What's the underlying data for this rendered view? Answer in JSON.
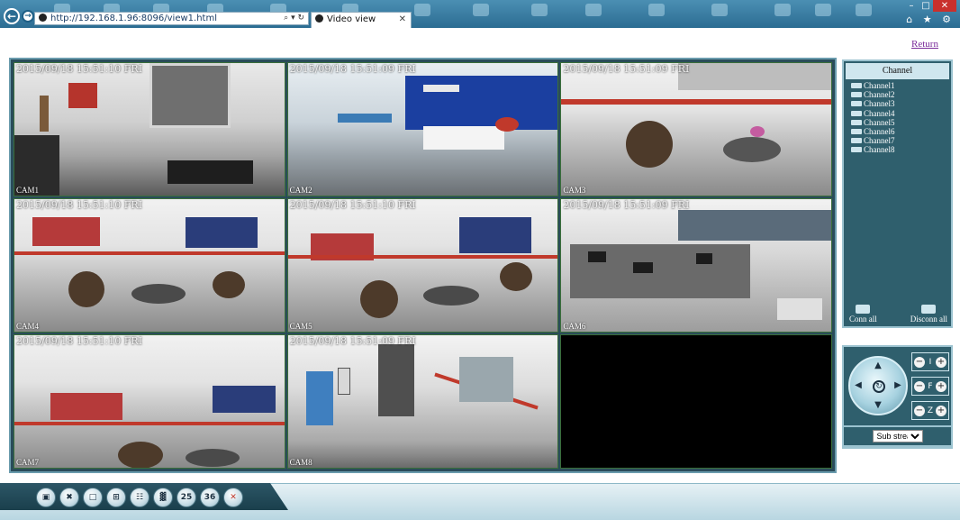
{
  "browser": {
    "address": "http://192.168.1.96:8096/view1.html",
    "address_tools": "⌕ ▾ ↻",
    "tab_title": "Video view",
    "tab_close": "✕",
    "tools": "⌂ ★ ⚙",
    "back_icon": "back-arrow-icon",
    "forward_icon": "forward-arrow-icon"
  },
  "header": {
    "return_label": "Return"
  },
  "video_cells": [
    {
      "timestamp": "2015/09/18 15:51:10 FRI",
      "label": "CAM1"
    },
    {
      "timestamp": "2015/09/18 15:51:09 FRI",
      "label": "CAM2"
    },
    {
      "timestamp": "2015/09/18 15:51:09 FRI",
      "label": "CAM3"
    },
    {
      "timestamp": "2015/09/18 15:51:10 FRI",
      "label": "CAM4"
    },
    {
      "timestamp": "2015/09/18 15:51:10 FRI",
      "label": "CAM5"
    },
    {
      "timestamp": "2015/09/18 15:51:09 FRI",
      "label": "CAM6"
    },
    {
      "timestamp": "2015/09/18 15:51:10 FRI",
      "label": "CAM7"
    },
    {
      "timestamp": "2015/09/18 15:51:09 FRI",
      "label": "CAM8"
    },
    {
      "timestamp": "",
      "label": ""
    }
  ],
  "channel_panel": {
    "title": "Channel",
    "channels": [
      "Channel1",
      "Channel2",
      "Channel3",
      "Channel4",
      "Channel5",
      "Channel6",
      "Channel7",
      "Channel8"
    ],
    "conn_all": "Conn all",
    "disconn_all": "Disconn all"
  },
  "ptz": {
    "iris": "I",
    "focus": "F",
    "zoom": "Z",
    "minus": "−",
    "plus": "+"
  },
  "stream": {
    "selected": "Sub stream",
    "options": [
      "Sub stream"
    ]
  },
  "toolbar": {
    "buttons": [
      {
        "name": "record-button",
        "icon": "camera-icon",
        "glyph": "▣"
      },
      {
        "name": "settings-button",
        "icon": "tools-icon",
        "glyph": "✖"
      },
      {
        "name": "layout-1-button",
        "icon": "layout-1-icon",
        "glyph": "□"
      },
      {
        "name": "layout-4-button",
        "icon": "layout-4-icon",
        "glyph": "⊞"
      },
      {
        "name": "layout-9-button",
        "icon": "layout-9-icon",
        "glyph": "☷"
      },
      {
        "name": "layout-16-button",
        "icon": "layout-16-icon",
        "glyph": "▓"
      },
      {
        "name": "layout-25-button",
        "icon": "layout-25-icon",
        "glyph": "25"
      },
      {
        "name": "layout-36-button",
        "icon": "layout-36-icon",
        "glyph": "36"
      },
      {
        "name": "mute-button",
        "icon": "speaker-mute-icon",
        "glyph": "✕"
      }
    ]
  }
}
